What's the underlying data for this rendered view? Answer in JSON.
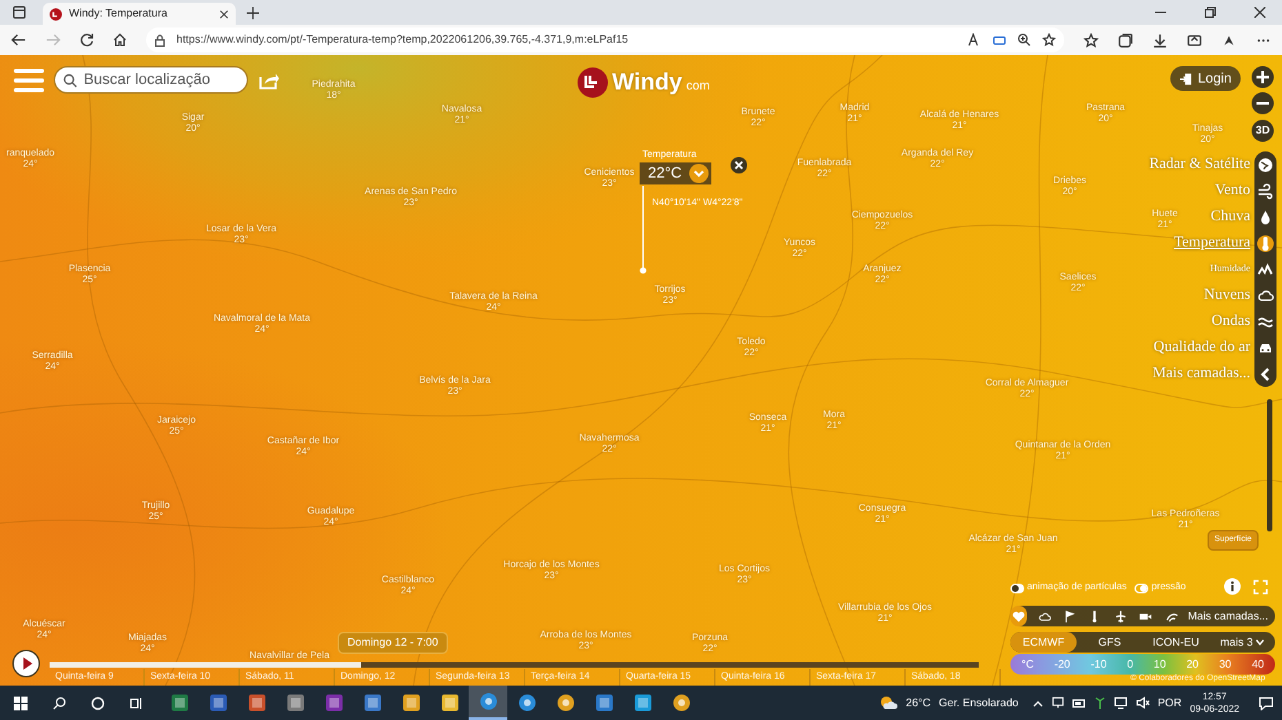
{
  "browser": {
    "tab": {
      "title": "Windy: Temperatura"
    },
    "url": "https://www.windy.com/pt/-Temperatura-temp?temp,2022061206,39.765,-4.371,9,m:eLPaf15"
  },
  "map": {
    "search": {
      "placeholder": "Buscar localização"
    },
    "logo": {
      "brand": "Windy",
      "suffix": "com"
    },
    "login": "Login",
    "view_3d": "3D",
    "cities": [
      {
        "name": "Piedrahita",
        "temp": "18°"
      },
      {
        "name": "Navalosa",
        "temp": "21°"
      },
      {
        "name": "Sigar",
        "temp": "20°"
      },
      {
        "name": "ranquelado",
        "temp": "24°"
      },
      {
        "name": "Arenas de San Pedro",
        "temp": "23°"
      },
      {
        "name": "Cenicientos",
        "temp": "23°"
      },
      {
        "name": "Losar de la Vera",
        "temp": "23°"
      },
      {
        "name": "Plasencia",
        "temp": "25°"
      },
      {
        "name": "Talavera de la Reina",
        "temp": "24°"
      },
      {
        "name": "Navalmoral de la Mata",
        "temp": "24°"
      },
      {
        "name": "Serradilla",
        "temp": "24°"
      },
      {
        "name": "Belvís de la Jara",
        "temp": "23°"
      },
      {
        "name": "Brunete",
        "temp": "22°"
      },
      {
        "name": "Madrid",
        "temp": "21°"
      },
      {
        "name": "Alcalá de Henares",
        "temp": "21°"
      },
      {
        "name": "Pastrana",
        "temp": "20°"
      },
      {
        "name": "Fuenlabrada",
        "temp": "22°"
      },
      {
        "name": "Arganda del Rey",
        "temp": "22°"
      },
      {
        "name": "Driebes",
        "temp": "20°"
      },
      {
        "name": "Tinajas",
        "temp": "20°"
      },
      {
        "name": "Ciempozuelos",
        "temp": "22°"
      },
      {
        "name": "Huete",
        "temp": "21°"
      },
      {
        "name": "Yuncos",
        "temp": "22°"
      },
      {
        "name": "Aranjuez",
        "temp": "22°"
      },
      {
        "name": "Saelices",
        "temp": "22°"
      },
      {
        "name": "Torrijos",
        "temp": "23°"
      },
      {
        "name": "Toledo",
        "temp": "22°"
      },
      {
        "name": "Corral de Almaguer",
        "temp": "22°"
      },
      {
        "name": "Sonseca",
        "temp": "21°"
      },
      {
        "name": "Mora",
        "temp": "21°"
      },
      {
        "name": "Quintanar de la Orden",
        "temp": "21°"
      },
      {
        "name": "Navahermosa",
        "temp": "22°"
      },
      {
        "name": "Jaraicejo",
        "temp": "25°"
      },
      {
        "name": "Castañar de Ibor",
        "temp": "24°"
      },
      {
        "name": "Trujillo",
        "temp": "25°"
      },
      {
        "name": "Guadalupe",
        "temp": "24°"
      },
      {
        "name": "Consuegra",
        "temp": "21°"
      },
      {
        "name": "Las Pedroñeras",
        "temp": "21°"
      },
      {
        "name": "Alcázar de San Juan",
        "temp": "21°"
      },
      {
        "name": "Horcajo de los Montes",
        "temp": "23°"
      },
      {
        "name": "Castilblanco",
        "temp": "24°"
      },
      {
        "name": "Los Cortijos",
        "temp": "23°"
      },
      {
        "name": "Villarrubia de los Ojos",
        "temp": "21°"
      },
      {
        "name": "Alcuéscar",
        "temp": "24°"
      },
      {
        "name": "Miajadas",
        "temp": "24°"
      },
      {
        "name": "Arroba de los Montes",
        "temp": "23°"
      },
      {
        "name": "Porzuna",
        "temp": "22°"
      },
      {
        "name": "Navalvillar de Pela"
      }
    ],
    "picker": {
      "label": "Temperatura",
      "value": "22°C",
      "coords": "N40°10'14\" W4°22'8\""
    },
    "layers": [
      {
        "label": "Radar & Satélite",
        "selected": false,
        "kind": "normal"
      },
      {
        "label": "Vento",
        "selected": false,
        "kind": "normal"
      },
      {
        "label": "Chuva",
        "selected": false,
        "kind": "normal"
      },
      {
        "label": "Temperatura",
        "selected": true,
        "kind": "normal"
      },
      {
        "label": "Humidade",
        "selected": false,
        "kind": "minor"
      },
      {
        "label": "Nuvens",
        "selected": false,
        "kind": "normal"
      },
      {
        "label": "Ondas",
        "selected": false,
        "kind": "normal"
      },
      {
        "label": "Qualidade do ar",
        "selected": false,
        "kind": "normal"
      },
      {
        "label": "Mais camadas...",
        "selected": false,
        "kind": "normal"
      }
    ],
    "level_button": "Superfície",
    "toggles": [
      {
        "label": "animação de partículas",
        "on": true
      },
      {
        "label": "pressão",
        "on": false
      }
    ],
    "quick_layers": {
      "items": [
        {
          "selected": true
        },
        {
          "selected": false
        },
        {
          "selected": false
        },
        {
          "selected": false
        },
        {
          "selected": false
        },
        {
          "selected": false
        },
        {
          "selected": false
        }
      ],
      "more": "Mais camadas..."
    },
    "models": [
      {
        "label": "ECMWF",
        "selected": true
      },
      {
        "label": "GFS",
        "selected": false
      },
      {
        "label": "ICON-EU",
        "selected": false
      },
      {
        "label": "mais 3",
        "selected": false
      }
    ],
    "legend": {
      "unit": "°C",
      "ticks": [
        "-20",
        "-10",
        "0",
        "10",
        "20",
        "30",
        "40"
      ]
    },
    "attribution": "© Colaboradores do OpenStreetMap"
  },
  "timeline": {
    "tooltip": "Domingo 12 - 7:00",
    "level": 0.335,
    "days": [
      "Quinta-feira 9",
      "Sexta-feira 10",
      "Sábado, 11",
      "Domingo, 12",
      "Segunda-feira 13",
      "Terça-feira 14",
      "Quarta-feira 15",
      "Quinta-feira 16",
      "Sexta-feira 17",
      "Sábado, 18"
    ]
  },
  "taskbar": {
    "apps": [
      {
        "active": false
      },
      {
        "active": false
      },
      {
        "active": false
      },
      {
        "active": false
      },
      {
        "active": false
      },
      {
        "active": false
      },
      {
        "active": false
      },
      {
        "active": false
      },
      {
        "active": true
      },
      {
        "active": false
      },
      {
        "active": false
      },
      {
        "active": false
      },
      {
        "active": false
      },
      {
        "active": false
      }
    ],
    "temperature": "26°C",
    "weather": "Ger. Ensolarado",
    "language": "POR",
    "time": "12:57",
    "date": "09-06-2022"
  }
}
